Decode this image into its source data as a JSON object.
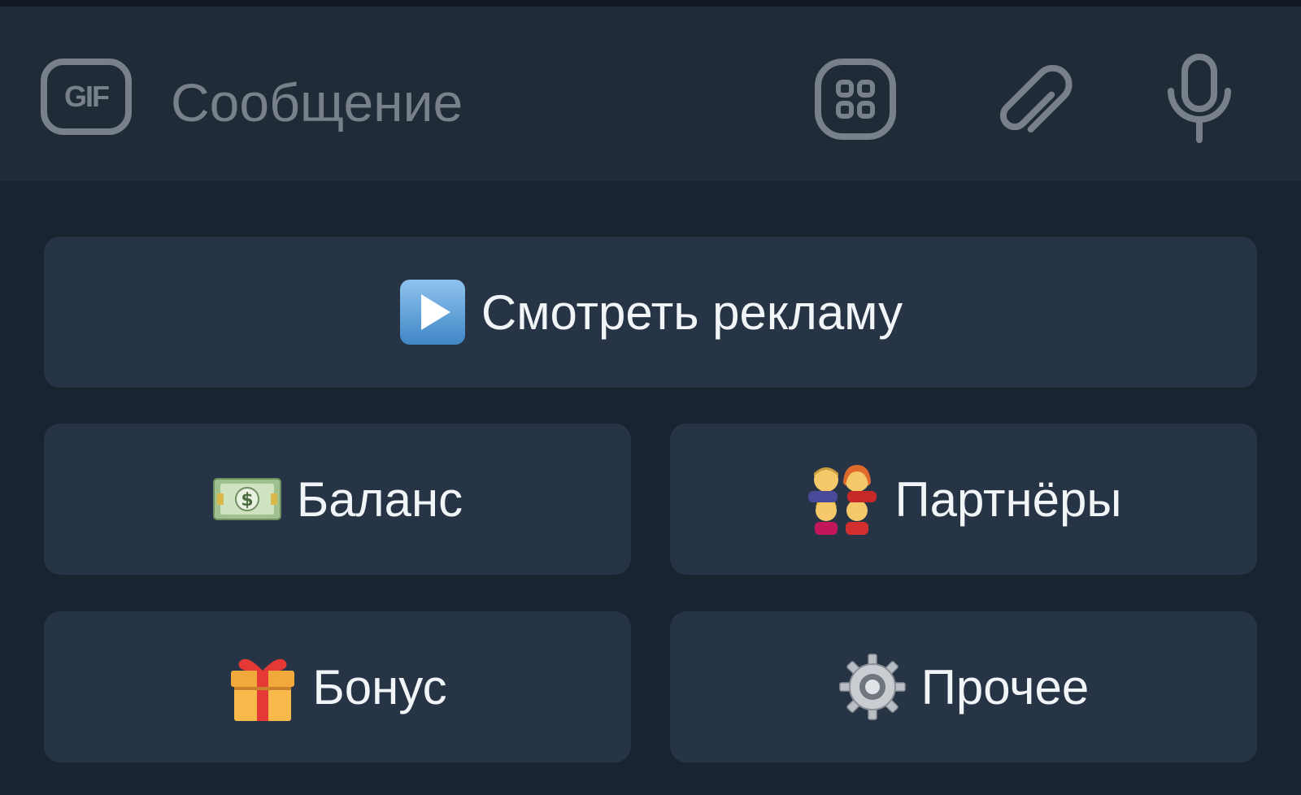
{
  "input_bar": {
    "gif_label": "GIF",
    "placeholder": "Сообщение",
    "icons": [
      "sticker-icon",
      "paperclip-icon",
      "microphone-icon"
    ]
  },
  "keyboard": {
    "buttons": [
      {
        "label": "Смотреть рекламу",
        "icon": "play-button-icon"
      },
      {
        "label": "Баланс",
        "icon": "money-icon"
      },
      {
        "label": "Партнёры",
        "icon": "family-icon"
      },
      {
        "label": "Бонус",
        "icon": "gift-icon"
      },
      {
        "label": "Прочее",
        "icon": "gear-icon"
      }
    ]
  },
  "colors": {
    "background": "#1a2431",
    "input_bar": "#202b38",
    "button": "#273445",
    "muted": "#77808b",
    "text": "#f2f5f8"
  }
}
